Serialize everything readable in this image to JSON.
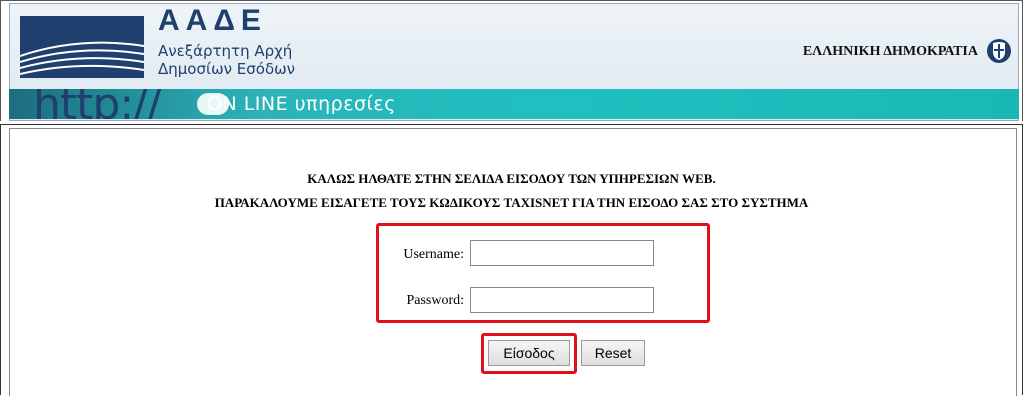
{
  "header": {
    "org_abbr": "ΑΑΔΕ",
    "org_line1": "Ανεξάρτητη Αρχή",
    "org_line2": "Δημοσίων Εσόδων",
    "republic": "ΕΛΛΗΝΙΚΗ ΔΗΜΟΚΡΑΤΙΑ",
    "banner_prefix": "http://",
    "banner_text": "ON LINE υπηρεσίες",
    "colors": {
      "brand_navy": "#1f3f6e",
      "banner_teal": "#1fc1c0"
    }
  },
  "main": {
    "welcome_line1": "ΚΑΛΩΣ ΗΛΘΑΤΕ ΣΤΗΝ ΣΕΛΙΔΑ ΕΙΣΟΔΟΥ ΤΩΝ ΥΠΗΡΕΣΙΩΝ WEB.",
    "welcome_line2": "ΠΑΡΑΚΑΛΟΥΜΕ ΕΙΣΑΓΕΤΕ ΤΟΥΣ ΚΩΔΙΚΟΥΣ TAXISNET ΓΙΑ ΤΗΝ ΕΙΣΟΔΟ ΣΑΣ ΣΤΟ ΣΥΣΤΗΜΑ"
  },
  "form": {
    "username_label": "Username:",
    "username_value": "",
    "password_label": "Password:",
    "password_value": "",
    "login_label": "Είσοδος",
    "reset_label": "Reset",
    "highlight_color": "#e0101a"
  }
}
